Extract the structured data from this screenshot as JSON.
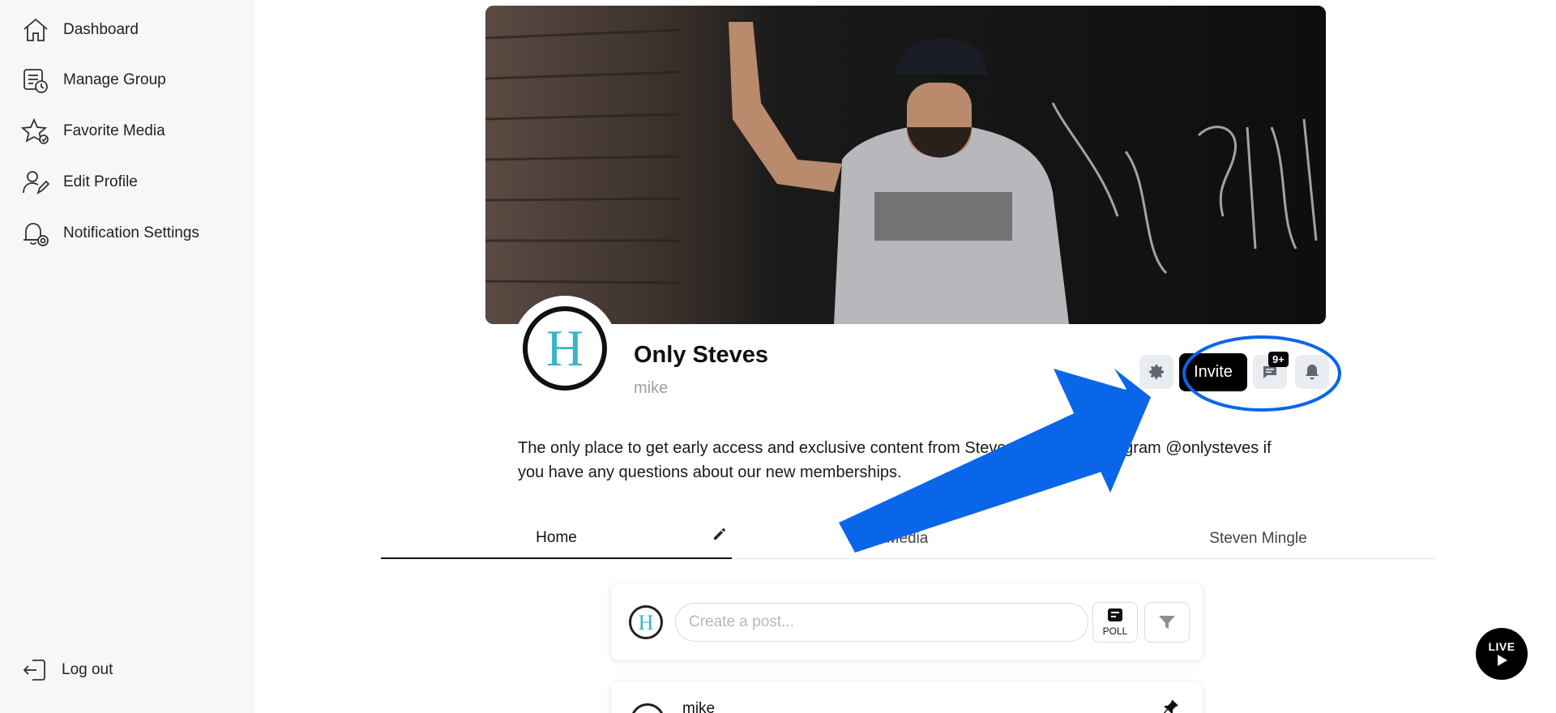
{
  "sidebar": {
    "items": [
      {
        "label": "Dashboard",
        "icon": "home-icon"
      },
      {
        "label": "Manage Group",
        "icon": "manage-group-icon"
      },
      {
        "label": "Favorite Media",
        "icon": "star-icon"
      },
      {
        "label": "Edit Profile",
        "icon": "edit-profile-icon"
      },
      {
        "label": "Notification Settings",
        "icon": "notification-settings-icon"
      }
    ],
    "logout_label": "Log out"
  },
  "group": {
    "name": "Only Steves",
    "owner": "mike",
    "avatar_letter": "H",
    "description": "The only place to get early access and exclusive content from Steve. DM us on Instagram @onlysteves if you have any questions about our new memberships.",
    "invite_label": "Invite",
    "messages_badge": "9+"
  },
  "tabs": [
    {
      "label": "Home",
      "active": true
    },
    {
      "label": "Media",
      "active": false
    },
    {
      "label": "Steven Mingle",
      "active": false
    }
  ],
  "composer": {
    "placeholder": "Create a post...",
    "poll_label": "POLL"
  },
  "post": {
    "author": "mike"
  },
  "live": {
    "label": "LIVE"
  },
  "colors": {
    "accent": "#0a66e8",
    "avatar_letter": "#37b6c4",
    "sidebar_bg": "#f7f7f7"
  }
}
